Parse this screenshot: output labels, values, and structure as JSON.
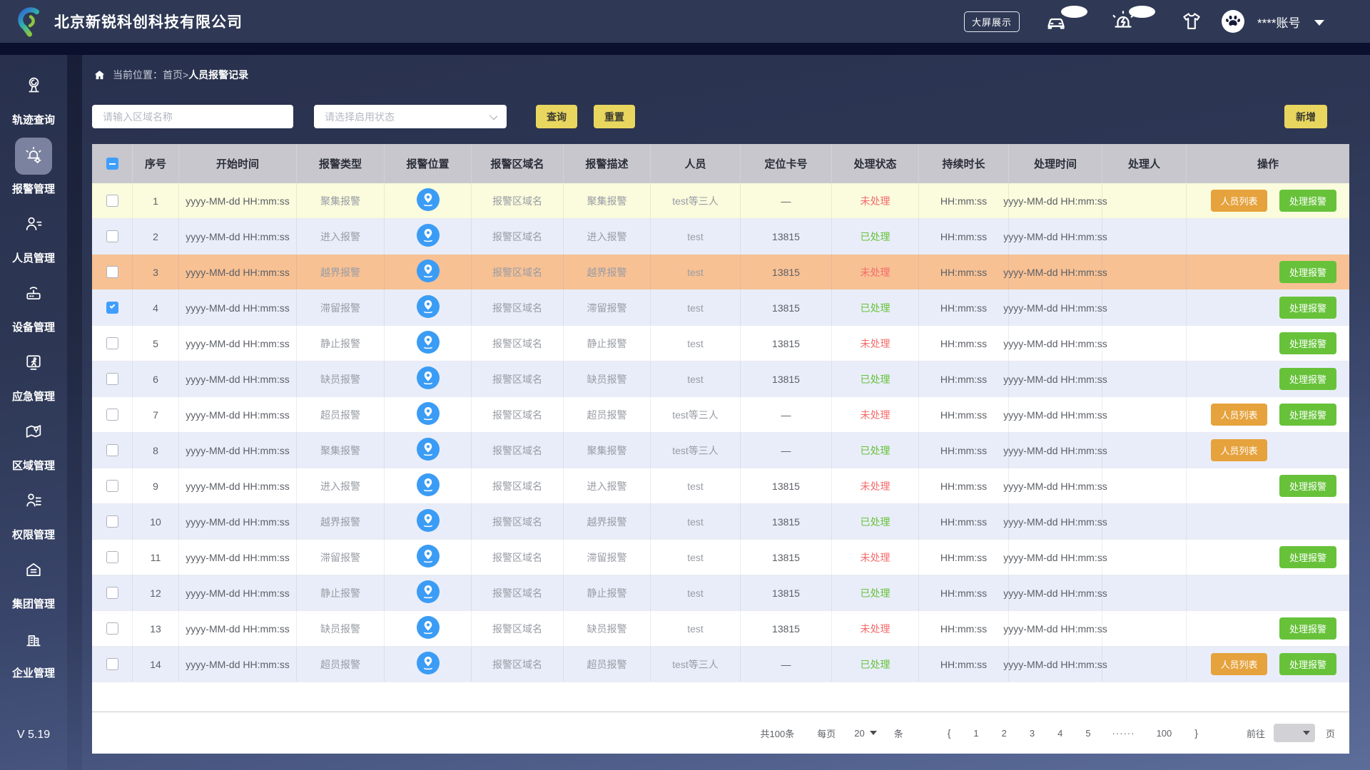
{
  "header": {
    "company": "北京新锐科创科技有限公司",
    "screen_button": "大屏展示",
    "account": "****账号"
  },
  "sidebar": {
    "items": [
      {
        "label": "轨迹查询",
        "icon": "track-query-icon",
        "active": false
      },
      {
        "label": "报警管理",
        "icon": "alarm-manage-icon",
        "active": true
      },
      {
        "label": "人员管理",
        "icon": "person-manage-icon",
        "active": false
      },
      {
        "label": "设备管理",
        "icon": "device-manage-icon",
        "active": false
      },
      {
        "label": "应急管理",
        "icon": "emergency-manage-icon",
        "active": false
      },
      {
        "label": "区域管理",
        "icon": "area-manage-icon",
        "active": false
      },
      {
        "label": "权限管理",
        "icon": "permission-manage-icon",
        "active": false
      },
      {
        "label": "集团管理",
        "icon": "group-manage-icon",
        "active": false
      },
      {
        "label": "企业管理",
        "icon": "enterprise-manage-icon",
        "active": false
      }
    ],
    "version": "V 5.19"
  },
  "breadcrumb": {
    "prefix": "当前位置：首页>",
    "current": "人员报警记录"
  },
  "toolbar": {
    "area_input_placeholder": "请输入区域名称",
    "status_select_placeholder": "请选择启用状态",
    "query_label": "查询",
    "reset_label": "重置",
    "add_label": "新增"
  },
  "table": {
    "columns": [
      "序号",
      "开始时间",
      "报警类型",
      "报警位置",
      "报警区域名",
      "报警描述",
      "人员",
      "定位卡号",
      "处理状态",
      "持续时长",
      "处理时间",
      "处理人",
      "操作"
    ],
    "action_labels": {
      "person_list": "人员列表",
      "handle_alarm": "处理报警"
    },
    "rows": [
      {
        "index": 1,
        "start_time": "yyyy-MM-dd HH:mm:ss",
        "type": "聚集报警",
        "area": "报警区域名",
        "desc": "聚集报警",
        "person": "test等三人",
        "card": "—",
        "status": "未处理",
        "status_color": "#f56c6c",
        "duration": "HH:mm:ss",
        "handle_time": "yyyy-MM-dd HH:mm:ss",
        "handler": "",
        "checked": false,
        "highlight": "yellow",
        "actions": [
          "person_list",
          "handle_alarm"
        ]
      },
      {
        "index": 2,
        "start_time": "yyyy-MM-dd HH:mm:ss",
        "type": "进入报警",
        "area": "报警区域名",
        "desc": "进入报警",
        "person": "test",
        "card": "13815",
        "status": "已处理",
        "status_color": "#67c23a",
        "duration": "HH:mm:ss",
        "handle_time": "yyyy-MM-dd HH:mm:ss",
        "handler": "",
        "checked": false,
        "highlight": "blue",
        "actions": []
      },
      {
        "index": 3,
        "start_time": "yyyy-MM-dd HH:mm:ss",
        "type": "越界报警",
        "area": "报警区域名",
        "desc": "越界报警",
        "person": "test",
        "card": "13815",
        "status": "未处理",
        "status_color": "#f56c6c",
        "duration": "HH:mm:ss",
        "handle_time": "yyyy-MM-dd HH:mm:ss",
        "handler": "",
        "checked": false,
        "highlight": "orange",
        "actions": [
          "handle_alarm"
        ]
      },
      {
        "index": 4,
        "start_time": "yyyy-MM-dd HH:mm:ss",
        "type": "滞留报警",
        "area": "报警区域名",
        "desc": "滞留报警",
        "person": "test",
        "card": "13815",
        "status": "已处理",
        "status_color": "#67c23a",
        "duration": "HH:mm:ss",
        "handle_time": "yyyy-MM-dd HH:mm:ss",
        "handler": "",
        "checked": true,
        "highlight": "blue",
        "actions": [
          "handle_alarm"
        ]
      },
      {
        "index": 5,
        "start_time": "yyyy-MM-dd HH:mm:ss",
        "type": "静止报警",
        "area": "报警区域名",
        "desc": "静止报警",
        "person": "test",
        "card": "13815",
        "status": "未处理",
        "status_color": "#f56c6c",
        "duration": "HH:mm:ss",
        "handle_time": "yyyy-MM-dd HH:mm:ss",
        "handler": "",
        "checked": false,
        "highlight": "white",
        "actions": [
          "handle_alarm"
        ]
      },
      {
        "index": 6,
        "start_time": "yyyy-MM-dd HH:mm:ss",
        "type": "缺员报警",
        "area": "报警区域名",
        "desc": "缺员报警",
        "person": "test",
        "card": "13815",
        "status": "已处理",
        "status_color": "#67c23a",
        "duration": "HH:mm:ss",
        "handle_time": "yyyy-MM-dd HH:mm:ss",
        "handler": "",
        "checked": false,
        "highlight": "blue",
        "actions": [
          "handle_alarm"
        ]
      },
      {
        "index": 7,
        "start_time": "yyyy-MM-dd HH:mm:ss",
        "type": "超员报警",
        "area": "报警区域名",
        "desc": "超员报警",
        "person": "test等三人",
        "card": "—",
        "status": "未处理",
        "status_color": "#f56c6c",
        "duration": "HH:mm:ss",
        "handle_time": "yyyy-MM-dd HH:mm:ss",
        "handler": "",
        "checked": false,
        "highlight": "white",
        "actions": [
          "person_list",
          "handle_alarm"
        ]
      },
      {
        "index": 8,
        "start_time": "yyyy-MM-dd HH:mm:ss",
        "type": "聚集报警",
        "area": "报警区域名",
        "desc": "聚集报警",
        "person": "test等三人",
        "card": "—",
        "status": "已处理",
        "status_color": "#67c23a",
        "duration": "HH:mm:ss",
        "handle_time": "yyyy-MM-dd HH:mm:ss",
        "handler": "",
        "checked": false,
        "highlight": "blue",
        "actions": [
          "person_list"
        ]
      },
      {
        "index": 9,
        "start_time": "yyyy-MM-dd HH:mm:ss",
        "type": "进入报警",
        "area": "报警区域名",
        "desc": "进入报警",
        "person": "test",
        "card": "13815",
        "status": "未处理",
        "status_color": "#f56c6c",
        "duration": "HH:mm:ss",
        "handle_time": "yyyy-MM-dd HH:mm:ss",
        "handler": "",
        "checked": false,
        "highlight": "white",
        "actions": [
          "handle_alarm"
        ]
      },
      {
        "index": 10,
        "start_time": "yyyy-MM-dd HH:mm:ss",
        "type": "越界报警",
        "area": "报警区域名",
        "desc": "越界报警",
        "person": "test",
        "card": "13815",
        "status": "已处理",
        "status_color": "#67c23a",
        "duration": "HH:mm:ss",
        "handle_time": "yyyy-MM-dd HH:mm:ss",
        "handler": "",
        "checked": false,
        "highlight": "blue",
        "actions": []
      },
      {
        "index": 11,
        "start_time": "yyyy-MM-dd HH:mm:ss",
        "type": "滞留报警",
        "area": "报警区域名",
        "desc": "滞留报警",
        "person": "test",
        "card": "13815",
        "status": "未处理",
        "status_color": "#f56c6c",
        "duration": "HH:mm:ss",
        "handle_time": "yyyy-MM-dd HH:mm:ss",
        "handler": "",
        "checked": false,
        "highlight": "white",
        "actions": [
          "handle_alarm"
        ]
      },
      {
        "index": 12,
        "start_time": "yyyy-MM-dd HH:mm:ss",
        "type": "静止报警",
        "area": "报警区域名",
        "desc": "静止报警",
        "person": "test",
        "card": "13815",
        "status": "已处理",
        "status_color": "#67c23a",
        "duration": "HH:mm:ss",
        "handle_time": "yyyy-MM-dd HH:mm:ss",
        "handler": "",
        "checked": false,
        "highlight": "blue",
        "actions": []
      },
      {
        "index": 13,
        "start_time": "yyyy-MM-dd HH:mm:ss",
        "type": "缺员报警",
        "area": "报警区域名",
        "desc": "缺员报警",
        "person": "test",
        "card": "13815",
        "status": "未处理",
        "status_color": "#f56c6c",
        "duration": "HH:mm:ss",
        "handle_time": "yyyy-MM-dd HH:mm:ss",
        "handler": "",
        "checked": false,
        "highlight": "white",
        "actions": [
          "handle_alarm"
        ]
      },
      {
        "index": 14,
        "start_time": "yyyy-MM-dd HH:mm:ss",
        "type": "超员报警",
        "area": "报警区域名",
        "desc": "超员报警",
        "person": "test等三人",
        "card": "—",
        "status": "已处理",
        "status_color": "#67c23a",
        "duration": "HH:mm:ss",
        "handle_time": "yyyy-MM-dd HH:mm:ss",
        "handler": "",
        "checked": false,
        "highlight": "blue",
        "actions": [
          "person_list",
          "handle_alarm"
        ]
      }
    ]
  },
  "pagination": {
    "total": "共100条",
    "per_page_prefix": "每页",
    "per_page_value": "20",
    "per_page_suffix": "条",
    "prev": "{",
    "pages": [
      "1",
      "2",
      "3",
      "4",
      "5"
    ],
    "ellipsis": "······",
    "last_page": "100",
    "next": "}",
    "goto_label": "前往",
    "goto_suffix": "页"
  },
  "colors": {
    "row": {
      "yellow": "#fbfbdd",
      "orange": "#f7c194",
      "blue": "#e9edf9",
      "white": "#ffffff"
    },
    "status_pending": "#f56c6c",
    "status_done": "#67c23a",
    "btn_person": "#e6a23c",
    "btn_handle": "#67c23a",
    "accent_yellow": "#e9d65f",
    "location_icon": "#3b9cf5",
    "checkbox_on": "#409eff"
  }
}
